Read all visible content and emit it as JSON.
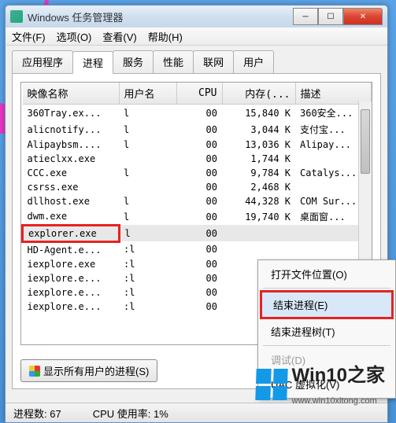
{
  "window": {
    "title": "Windows 任务管理器"
  },
  "menu": {
    "file": "文件(F)",
    "options": "选项(O)",
    "view": "查看(V)",
    "help": "帮助(H)"
  },
  "tabs": {
    "apps": "应用程序",
    "processes": "进程",
    "services": "服务",
    "performance": "性能",
    "networking": "联网",
    "users": "用户"
  },
  "columns": {
    "image": "映像名称",
    "user": "用户名",
    "cpu": "CPU",
    "memory": "内存(...",
    "desc": "描述"
  },
  "rows": [
    {
      "img": "360Tray.ex...",
      "user": "l",
      "cpu": "00",
      "mem": "15,840 K",
      "desc": "360安全..."
    },
    {
      "img": "alicnotify...",
      "user": "l",
      "cpu": "00",
      "mem": "3,044 K",
      "desc": "支付宝..."
    },
    {
      "img": "Alipaybsm....",
      "user": "l",
      "cpu": "00",
      "mem": "13,036 K",
      "desc": "Alipay..."
    },
    {
      "img": "atieclxx.exe",
      "user": "",
      "cpu": "00",
      "mem": "1,744 K",
      "desc": ""
    },
    {
      "img": "CCC.exe",
      "user": "l",
      "cpu": "00",
      "mem": "9,784 K",
      "desc": "Catalys..."
    },
    {
      "img": "csrss.exe",
      "user": "",
      "cpu": "00",
      "mem": "2,468 K",
      "desc": ""
    },
    {
      "img": "dllhost.exe",
      "user": "l",
      "cpu": "00",
      "mem": "44,328 K",
      "desc": "COM Sur..."
    },
    {
      "img": "dwm.exe",
      "user": "l",
      "cpu": "00",
      "mem": "19,740 K",
      "desc": "桌面窗..."
    },
    {
      "img": "explorer.exe",
      "user": "l",
      "cpu": "00",
      "mem": "",
      "desc": "",
      "hl": true
    },
    {
      "img": "HD-Agent.e...",
      "user": ":l",
      "cpu": "00",
      "mem": "",
      "desc": ""
    },
    {
      "img": "iexplore.exe",
      "user": ":l",
      "cpu": "00",
      "mem": "",
      "desc": ""
    },
    {
      "img": "iexplore.e...",
      "user": ":l",
      "cpu": "00",
      "mem": "",
      "desc": ""
    },
    {
      "img": "iexplore.e...",
      "user": ":l",
      "cpu": "00",
      "mem": "",
      "desc": ""
    },
    {
      "img": "iexplore.e...",
      "user": ":l",
      "cpu": "00",
      "mem": "",
      "desc": ""
    }
  ],
  "show_all_button": "显示所有用户的进程(S)",
  "status": {
    "processes": "进程数: 67",
    "cpu": "CPU 使用率: 1%"
  },
  "context_menu": {
    "open_location": "打开文件位置(O)",
    "end_process": "结束进程(E)",
    "end_tree": "结束进程树(T)",
    "debug": "调试(D)",
    "uac": "UAC 虚拟化(V)"
  },
  "watermark": {
    "brand": "Win10",
    "suffix": "之家",
    "url": "www.win10xitong.com"
  }
}
